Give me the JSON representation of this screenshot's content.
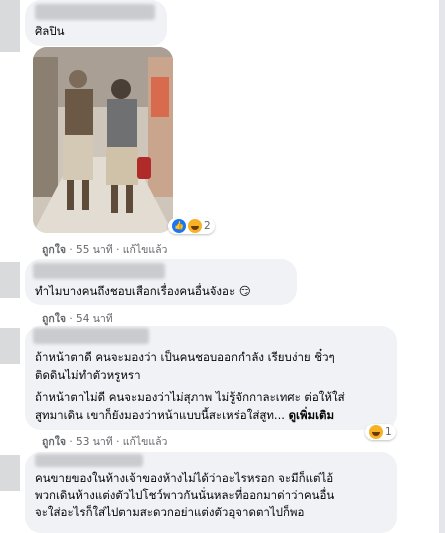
{
  "comments": [
    {
      "text": "ศิลปิน",
      "reaction_count": "2",
      "meta": {
        "like": "ถูกใจ",
        "time": "55 นาที",
        "edit": "แก้ไขแล้ว"
      }
    },
    {
      "text": "ทำไมบางคนถึงชอบเสือกเรื่องคนอื่นจังอะ 😏",
      "meta": {
        "like": "ถูกใจ",
        "time": "54 นาที"
      }
    },
    {
      "text1": "ถ้าหน้าตาดี คนจะมองว่า เป็นคนชอบออกกำลัง เรียบง่าย ชิ๋วๆ\nติดดินไม่ทำตัวหรูหรา",
      "text2": "ถ้าหน้าตาไม่ดี คนจะมองว่าไม่สุภาพ ไม่รู้จักกาละเทศะ ต่อให้ใส่\nสูทมาเดิน เขาก็ยังมองว่าหน้าแบบนี้สะเหร่อใส่สูท...",
      "see_more": "ดูเพิ่มเติม",
      "reaction_count": "1",
      "meta": {
        "like": "ถูกใจ",
        "time": "53 นาที",
        "edit": "แก้ไขแล้ว"
      }
    },
    {
      "text": "คนขายของในห้างเจ้าของห้างไม่ได้ว่าอะไรหรอก จะมีก็แต่ไอ้\nพวกเดินห้างแต่งตัวไปโชว์พาวกันนั่นหละที่ออกมาด่าว่าคนอื่น\nจะใส่อะไรก็ใส่ไปตามสะดวกอย่าแต่งตัวอุจาดตาไปก็พอ"
    }
  ]
}
